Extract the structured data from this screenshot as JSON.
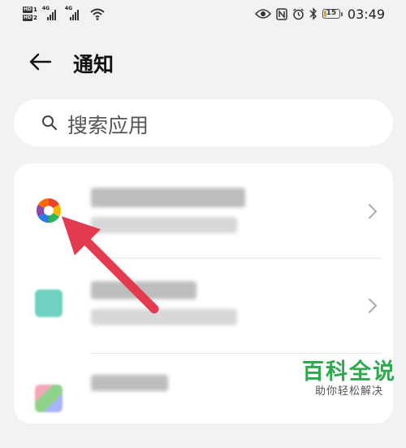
{
  "status_bar": {
    "sim1": "HD",
    "sim1_slot": "1",
    "sim2": "HD",
    "sim2_slot": "2",
    "net1": "4G",
    "net2": "4G",
    "battery_level": "15",
    "time": "03:49",
    "icons": [
      "eye-icon",
      "nfc-icon",
      "alarm-icon",
      "bluetooth-icon",
      "battery-icon",
      "wifi-icon",
      "signal-icon"
    ]
  },
  "header": {
    "title": "通知",
    "back_icon": "back-arrow-icon"
  },
  "search": {
    "placeholder": "搜索应用",
    "icon": "search-icon"
  },
  "apps": [
    {
      "icon": "pinwheel-app-icon",
      "colors": [
        "#e8412c",
        "#f6b700",
        "#2eb55b",
        "#2c7be5",
        "#8e44ad"
      ],
      "chevron": "chevron-right-icon"
    },
    {
      "icon": "teal-app-icon",
      "colors": [
        "#6fd1bf"
      ],
      "chevron": "chevron-right-icon"
    },
    {
      "icon": "multicolor-app-icon",
      "colors": [
        "#f3a6b8",
        "#8fd38a",
        "#a8b4ff"
      ],
      "chevron": "chevron-right-icon"
    }
  ],
  "annotation": {
    "color": "#e23b4f",
    "icon": "red-pointer-arrow"
  },
  "watermark": {
    "title": "百科全说",
    "subtitle": "助你轻松解决",
    "color": "#2fa84f"
  }
}
